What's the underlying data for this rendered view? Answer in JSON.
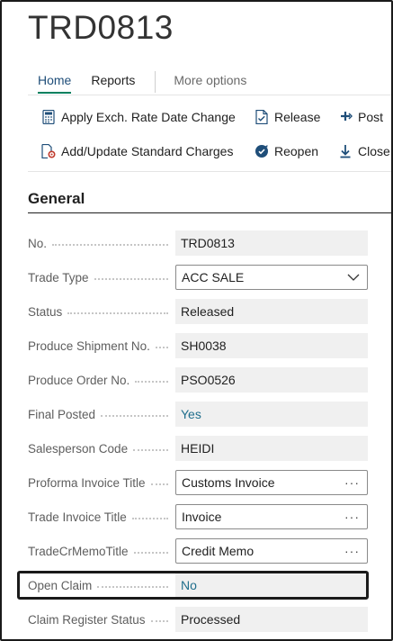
{
  "page": {
    "title": "TRD0813"
  },
  "tabs": [
    {
      "label": "Home"
    },
    {
      "label": "Reports"
    },
    {
      "label": "More options"
    }
  ],
  "actions": {
    "apply_exch": "Apply Exch. Rate Date Change",
    "release": "Release",
    "post": "Post",
    "add_update": "Add/Update Standard Charges",
    "reopen": "Reopen",
    "close": "Close"
  },
  "section": {
    "title": "General"
  },
  "fields": [
    {
      "label": "No.",
      "value": "TRD0813"
    },
    {
      "label": "Trade Type",
      "value": "ACC SALE"
    },
    {
      "label": "Status",
      "value": "Released"
    },
    {
      "label": "Produce Shipment No.",
      "value": "SH0038"
    },
    {
      "label": "Produce Order No.",
      "value": "PSO0526"
    },
    {
      "label": "Final Posted",
      "value": "Yes"
    },
    {
      "label": "Salesperson Code",
      "value": "HEIDI"
    },
    {
      "label": "Proforma Invoice Title",
      "value": "Customs Invoice"
    },
    {
      "label": "Trade Invoice Title",
      "value": "Invoice"
    },
    {
      "label": "TradeCrMemoTitle",
      "value": "Credit Memo"
    },
    {
      "label": "Open Claim",
      "value": "No"
    },
    {
      "label": "Claim Register Status",
      "value": "Processed"
    }
  ],
  "assist_button": "···",
  "colors": {
    "accent": "#00805f",
    "link": "#1f6e8c",
    "field_bg": "#f0f0f0"
  }
}
